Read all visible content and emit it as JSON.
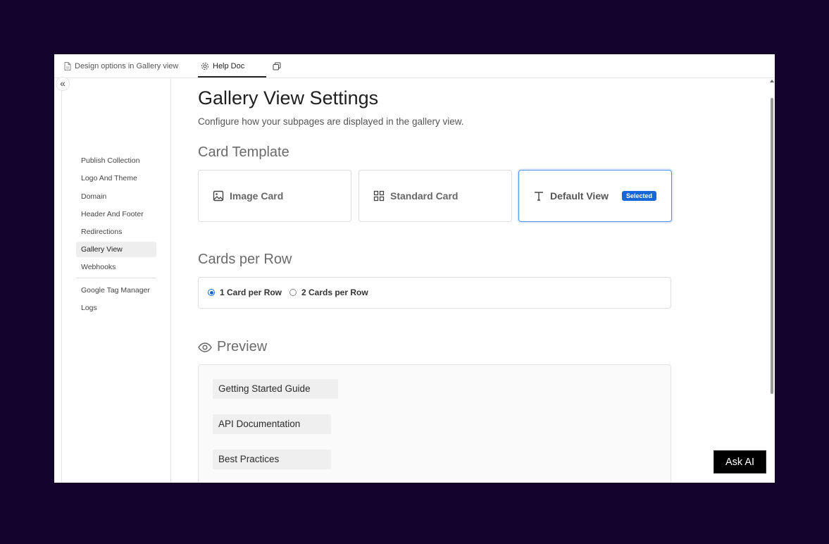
{
  "tabs": {
    "design_tab": "Design options in Gallery view",
    "help_tab": "Help Doc"
  },
  "sidebar": {
    "collapse_glyph": "«",
    "items": [
      {
        "label": "Publish Collection"
      },
      {
        "label": "Logo And Theme"
      },
      {
        "label": "Domain"
      },
      {
        "label": "Header And Footer"
      },
      {
        "label": "Redirections"
      },
      {
        "label": "Gallery View",
        "active": true
      },
      {
        "label": "Webhooks"
      },
      {
        "label": "Google Tag Manager"
      },
      {
        "label": "Logs"
      }
    ]
  },
  "main": {
    "title": "Gallery View Settings",
    "subtitle": "Configure how your subpages are displayed in the gallery view.",
    "card_template_heading": "Card Template",
    "cards": [
      {
        "label": "Image Card",
        "icon": "image-icon"
      },
      {
        "label": "Standard Card",
        "icon": "grid-icon"
      },
      {
        "label": "Default View",
        "icon": "text-icon",
        "badge": "Selected",
        "selected": true
      }
    ],
    "cards_per_row_heading": "Cards per Row",
    "radios": [
      {
        "label": "1 Card per Row",
        "checked": true
      },
      {
        "label": "2 Cards per Row",
        "checked": false
      }
    ],
    "preview_heading": "Preview",
    "preview_items": [
      "Getting Started Guide",
      "API Documentation",
      "Best Practices"
    ]
  },
  "ask_ai": "Ask AI",
  "colors": {
    "page_bg": "#14042b",
    "accent": "#1767d8",
    "selected_border": "#4d8de6"
  }
}
